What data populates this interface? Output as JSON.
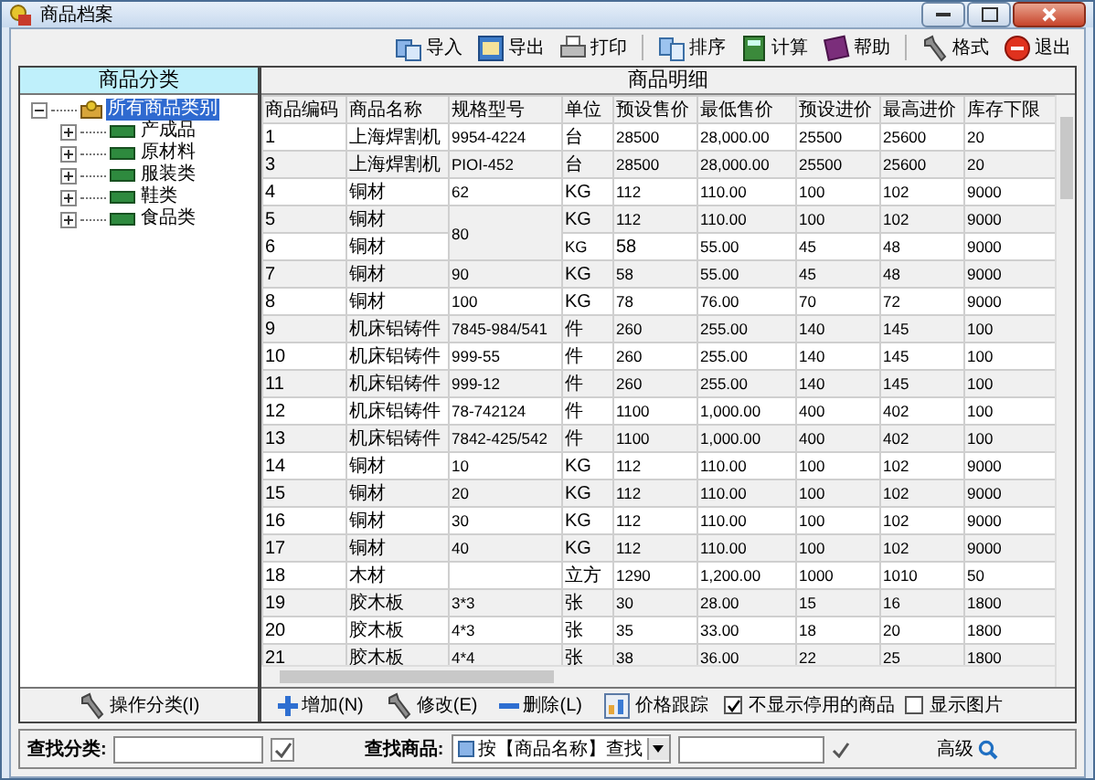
{
  "window": {
    "title": "商品档案"
  },
  "toolbar": [
    [
      {
        "label": "导入"
      },
      {
        "label": "导出"
      },
      {
        "label": "打印"
      }
    ],
    [
      {
        "label": "排序"
      },
      {
        "label": "计算"
      },
      {
        "label": "帮助"
      }
    ],
    [
      {
        "label": "格式"
      },
      {
        "label": "退出"
      }
    ]
  ],
  "category_panel": {
    "title": "商品分类",
    "tree": [
      {
        "label": "所有商品类别",
        "selected": true,
        "expanded": true,
        "children": [
          {
            "label": "产成品",
            "selected": false,
            "expanded": false
          },
          {
            "label": "原材料",
            "selected": false,
            "expanded": false
          },
          {
            "label": "服装类",
            "selected": false,
            "expanded": false
          },
          {
            "label": "鞋类",
            "selected": false,
            "expanded": false
          },
          {
            "label": "食品类",
            "selected": false,
            "expanded": false
          }
        ]
      }
    ],
    "button": "操作分类(I)"
  },
  "detail_panel": {
    "title": "商品明细",
    "table": {
      "columns": [
        "商品编码",
        "商品名称",
        "规格型号",
        "单位",
        "预设售价",
        "最低售价",
        "预设进价",
        "最高进价",
        "库存下限"
      ],
      "rows": [
        [
          "1",
          "上海焊割机",
          "9954-4224",
          "台",
          "28500",
          "28,000.00",
          "25500",
          "25600",
          "20"
        ],
        [
          "3",
          "上海焊割机",
          "PIOI-452",
          "台",
          "28500",
          "28,000.00",
          "25500",
          "25600",
          "20"
        ],
        [
          "4",
          "铜材",
          "62",
          "KG",
          "112",
          "110.00",
          "100",
          "102",
          "9000"
        ],
        [
          "5",
          "铜材",
          {
            "text": "80",
            "rowspan": 2
          },
          "KG",
          "112",
          "110.00",
          "100",
          "102",
          "9000"
        ],
        [
          "6",
          "铜材",
          "KG",
          "58",
          "55.00",
          "45",
          "48",
          "9000"
        ],
        [
          "7",
          "铜材",
          "90",
          "KG",
          "58",
          "55.00",
          "45",
          "48",
          "9000"
        ],
        [
          "8",
          "铜材",
          "100",
          "KG",
          "78",
          "76.00",
          "70",
          "72",
          "9000"
        ],
        [
          "9",
          "机床铝铸件",
          "7845-984/541",
          "件",
          "260",
          "255.00",
          "140",
          "145",
          "100"
        ],
        [
          "10",
          "机床铝铸件",
          "999-55",
          "件",
          "260",
          "255.00",
          "140",
          "145",
          "100"
        ],
        [
          "11",
          "机床铝铸件",
          "999-12",
          "件",
          "260",
          "255.00",
          "140",
          "145",
          "100"
        ],
        [
          "12",
          "机床铝铸件",
          "78-742124",
          "件",
          "1100",
          "1,000.00",
          "400",
          "402",
          "100"
        ],
        [
          "13",
          "机床铝铸件",
          "7842-425/542",
          "件",
          "1100",
          "1,000.00",
          "400",
          "402",
          "100"
        ],
        [
          "14",
          "铜材",
          "10",
          "KG",
          "112",
          "110.00",
          "100",
          "102",
          "9000"
        ],
        [
          "15",
          "铜材",
          "20",
          "KG",
          "112",
          "110.00",
          "100",
          "102",
          "9000"
        ],
        [
          "16",
          "铜材",
          "30",
          "KG",
          "112",
          "110.00",
          "100",
          "102",
          "9000"
        ],
        [
          "17",
          "铜材",
          "40",
          "KG",
          "112",
          "110.00",
          "100",
          "102",
          "9000"
        ],
        [
          "18",
          "木材",
          "",
          "立方",
          "1290",
          "1,200.00",
          "1000",
          "1010",
          "50"
        ],
        [
          "19",
          "胶木板",
          "3*3",
          "张",
          "30",
          "28.00",
          "15",
          "16",
          "1800"
        ],
        [
          "20",
          "胶木板",
          "4*3",
          "张",
          "35",
          "33.00",
          "18",
          "20",
          "1800"
        ],
        [
          "21",
          "胶木板",
          "4*4",
          "张",
          "38",
          "36.00",
          "22",
          "25",
          "1800"
        ]
      ]
    },
    "actions": [
      {
        "kind": "button",
        "label": "增加(N)"
      },
      {
        "kind": "button",
        "label": "修改(E)"
      },
      {
        "kind": "button",
        "label": "删除(L)"
      },
      {
        "kind": "button",
        "label": "价格跟踪"
      },
      {
        "kind": "checkbox",
        "label": "不显示停用的商品",
        "checked": true
      },
      {
        "kind": "checkbox",
        "label": "显示图片",
        "checked": false
      }
    ]
  },
  "search_bar": {
    "category_label": "查找分类:",
    "product_label": "查找商品:",
    "product_mode": "按【商品名称】查找",
    "advanced": "高级"
  }
}
